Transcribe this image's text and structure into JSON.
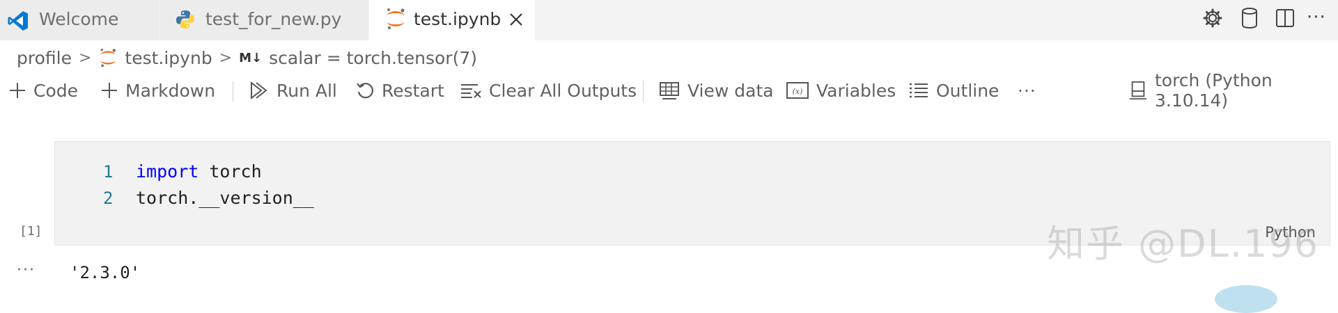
{
  "tabs": [
    {
      "label": "Welcome",
      "icon": "vscode-icon"
    },
    {
      "label": "test_for_new.py",
      "icon": "python-icon"
    },
    {
      "label": "test.ipynb",
      "icon": "jupyter-icon",
      "active": true
    }
  ],
  "breadcrumb": {
    "folder": "profile",
    "file": "test.ipynb",
    "md_badge": "M↓",
    "symbol": "scalar = torch.tensor(7)"
  },
  "toolbar": {
    "code": "Code",
    "markdown": "Markdown",
    "run_all": "Run All",
    "restart": "Restart",
    "clear_outputs": "Clear All Outputs",
    "view_data": "View data",
    "variables": "Variables",
    "outline": "Outline",
    "more": "···",
    "kernel": "torch (Python 3.10.14)"
  },
  "cell": {
    "line_numbers": [
      "1",
      "2"
    ],
    "keyword": "import",
    "line1_rest": " torch",
    "line2": "torch.__version__",
    "execution_count": "[1]",
    "language": "Python"
  },
  "output": {
    "more": "···",
    "text": "'2.3.0'"
  },
  "watermark": "知乎 @DL.196",
  "colors": {
    "tabbar_bg": "#f3f3f3",
    "active_tab_bg": "#ffffff",
    "cell_bg": "#f2f2f2",
    "keyword": "#0000ff",
    "line_number": "#237893",
    "vscode_blue": "#0078d4",
    "jupyter_orange": "#f37626"
  }
}
